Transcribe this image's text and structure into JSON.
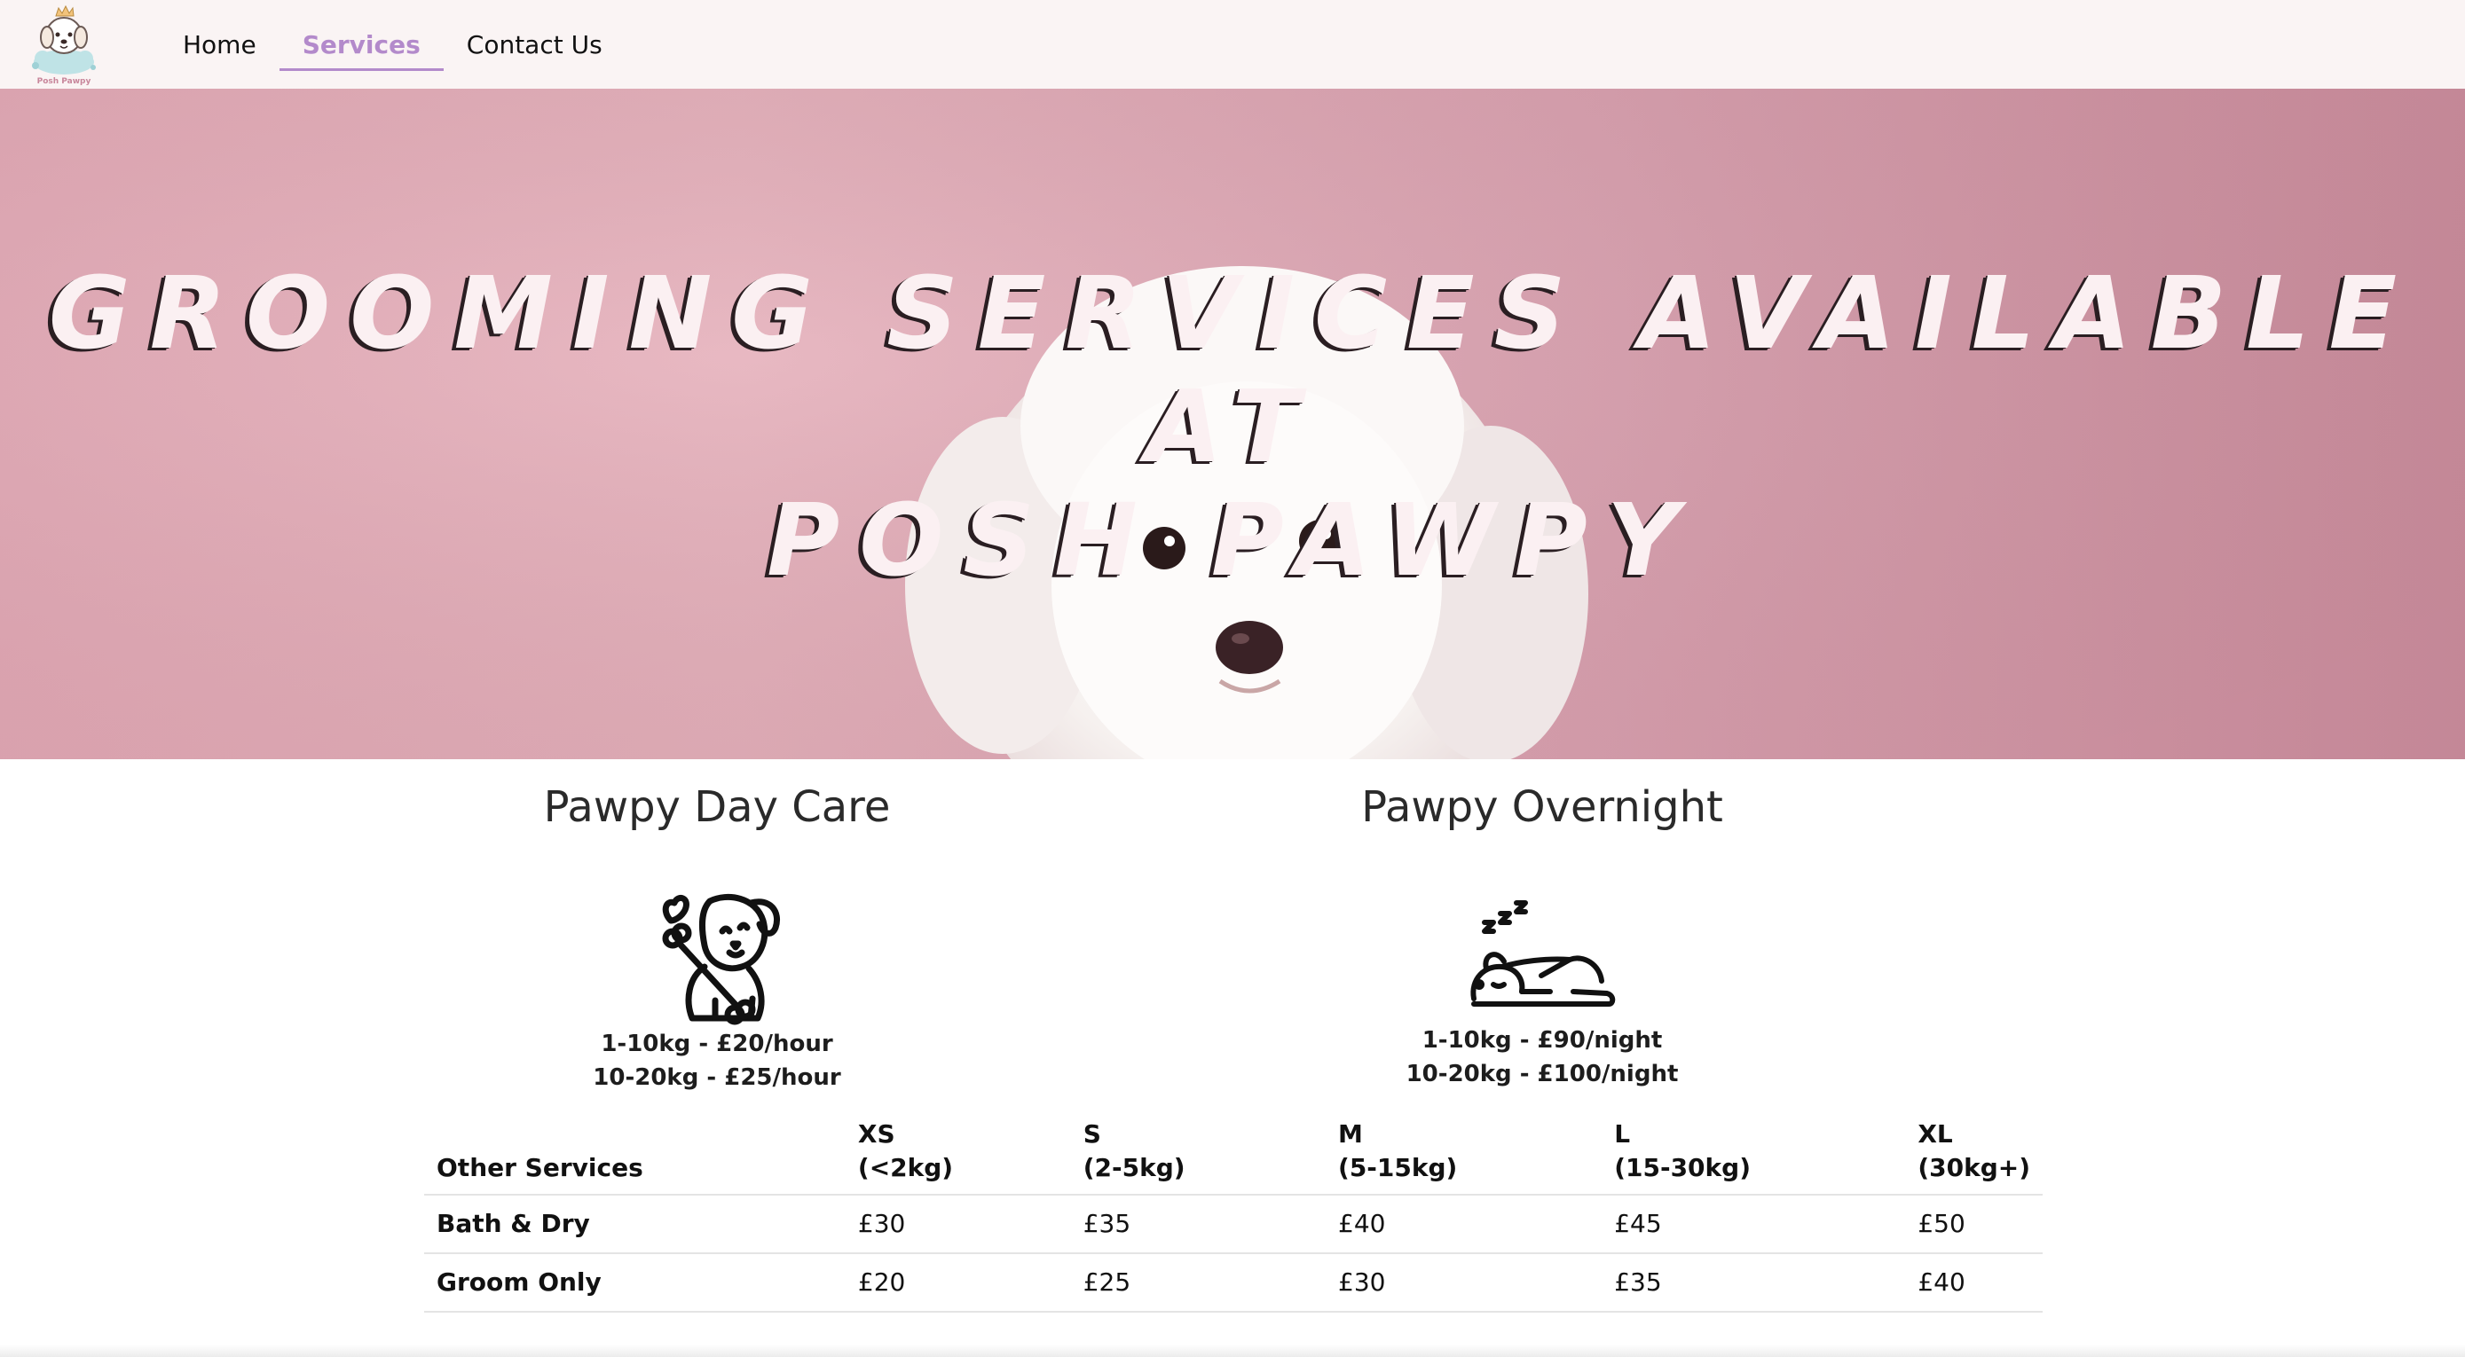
{
  "brand": {
    "logo_text": "Posh Pawpy",
    "colors": {
      "accent": "#b38acb",
      "hero_pink": "#e3a8b5",
      "nav_background": "#faf4f4"
    }
  },
  "nav": {
    "items": [
      {
        "label": "Home",
        "active": false
      },
      {
        "label": "Services",
        "active": true
      },
      {
        "label": "Contact Us",
        "active": false
      }
    ]
  },
  "hero": {
    "title_line1": "GROOMING SERVICES AVAILABLE AT",
    "title_line2": "POSH PAWPY"
  },
  "services": {
    "daycare": {
      "title": "Pawpy Day Care",
      "icon": "dog-with-bone-icon",
      "prices": [
        "1-10kg - £20/hour",
        "10-20kg - £25/hour"
      ]
    },
    "overnight": {
      "title": "Pawpy Overnight",
      "icon": "sleeping-dog-icon",
      "prices": [
        "1-10kg - £90/night",
        "10-20kg - £100/night"
      ]
    }
  },
  "table": {
    "headers": [
      {
        "line1": "",
        "line2": "Other Services"
      },
      {
        "line1": "XS",
        "line2": "(<2kg)"
      },
      {
        "line1": "S",
        "line2": "(2-5kg)"
      },
      {
        "line1": "M",
        "line2": "(5-15kg)"
      },
      {
        "line1": "L",
        "line2": "(15-30kg)"
      },
      {
        "line1": "XL",
        "line2": "(30kg+)"
      }
    ],
    "rows": [
      [
        "Bath & Dry",
        "£30",
        "£35",
        "£40",
        "£45",
        "£50"
      ],
      [
        "Groom Only",
        "£20",
        "£25",
        "£30",
        "£35",
        "£40"
      ]
    ]
  }
}
